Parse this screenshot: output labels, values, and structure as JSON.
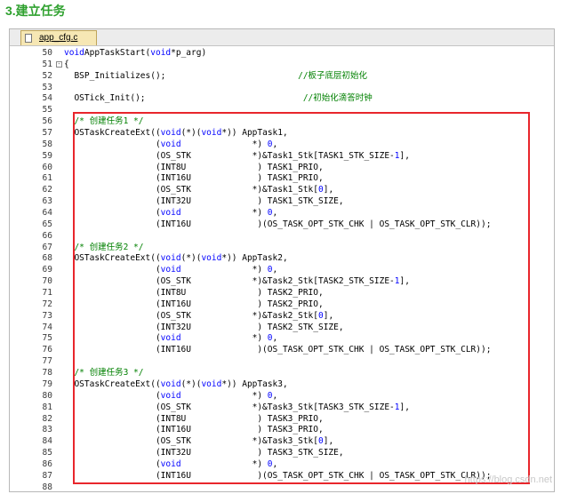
{
  "heading": "3.建立任务",
  "tab_label": "app_cfg.c",
  "watermark": "https://blog.csdn.net",
  "lines": [
    {
      "n": "50",
      "t": [
        [
          "kw",
          "void"
        ],
        [
          "",
          "AppTaskStart("
        ],
        [
          "kw",
          "void"
        ],
        [
          "",
          "*p_arg)"
        ]
      ]
    },
    {
      "n": "51",
      "fold": "-",
      "t": [
        [
          "",
          "{"
        ]
      ]
    },
    {
      "n": "52",
      "t": [
        [
          "",
          "  BSP_Initializes();                          "
        ],
        [
          "cm",
          "//板子底层初始化"
        ]
      ]
    },
    {
      "n": "53",
      "t": []
    },
    {
      "n": "54",
      "t": [
        [
          "",
          "  OSTick_Init();                               "
        ],
        [
          "cm",
          "//初始化滴答时钟"
        ]
      ]
    },
    {
      "n": "55",
      "t": []
    },
    {
      "n": "56",
      "t": [
        [
          "cm",
          "  /* 创建任务1 */"
        ]
      ]
    },
    {
      "n": "57",
      "t": [
        [
          "",
          "  OSTaskCreateExt(("
        ],
        [
          "kw",
          "void"
        ],
        [
          "",
          "(*)("
        ],
        [
          "kw",
          "void"
        ],
        [
          "",
          "*)) AppTask1,"
        ]
      ]
    },
    {
      "n": "58",
      "t": [
        [
          "",
          "                  ("
        ],
        [
          "kw",
          "void"
        ],
        [
          "",
          "              *) "
        ],
        [
          "kw",
          "0"
        ],
        [
          "",
          ","
        ]
      ]
    },
    {
      "n": "59",
      "t": [
        [
          "",
          "                  (OS_STK            *)&Task1_Stk[TASK1_STK_SIZE-"
        ],
        [
          "kw",
          "1"
        ],
        [
          "",
          "],"
        ]
      ]
    },
    {
      "n": "60",
      "t": [
        [
          "",
          "                  (INT8U              ) TASK1_PRIO,"
        ]
      ]
    },
    {
      "n": "61",
      "t": [
        [
          "",
          "                  (INT16U             ) TASK1_PRIO,"
        ]
      ]
    },
    {
      "n": "62",
      "t": [
        [
          "",
          "                  (OS_STK            *)&Task1_Stk["
        ],
        [
          "kw",
          "0"
        ],
        [
          "",
          "],"
        ]
      ]
    },
    {
      "n": "63",
      "t": [
        [
          "",
          "                  (INT32U             ) TASK1_STK_SIZE,"
        ]
      ]
    },
    {
      "n": "64",
      "t": [
        [
          "",
          "                  ("
        ],
        [
          "kw",
          "void"
        ],
        [
          "",
          "              *) "
        ],
        [
          "kw",
          "0"
        ],
        [
          "",
          ","
        ]
      ]
    },
    {
      "n": "65",
      "t": [
        [
          "",
          "                  (INT16U             )(OS_TASK_OPT_STK_CHK | OS_TASK_OPT_STK_CLR));"
        ]
      ]
    },
    {
      "n": "66",
      "t": []
    },
    {
      "n": "67",
      "t": [
        [
          "cm",
          "  /* 创建任务2 */"
        ]
      ]
    },
    {
      "n": "68",
      "t": [
        [
          "",
          "  OSTaskCreateExt(("
        ],
        [
          "kw",
          "void"
        ],
        [
          "",
          "(*)("
        ],
        [
          "kw",
          "void"
        ],
        [
          "",
          "*)) AppTask2,"
        ]
      ]
    },
    {
      "n": "69",
      "t": [
        [
          "",
          "                  ("
        ],
        [
          "kw",
          "void"
        ],
        [
          "",
          "              *) "
        ],
        [
          "kw",
          "0"
        ],
        [
          "",
          ","
        ]
      ]
    },
    {
      "n": "70",
      "t": [
        [
          "",
          "                  (OS_STK            *)&Task2_Stk[TASK2_STK_SIZE-"
        ],
        [
          "kw",
          "1"
        ],
        [
          "",
          "],"
        ]
      ]
    },
    {
      "n": "71",
      "t": [
        [
          "",
          "                  (INT8U              ) TASK2_PRIO,"
        ]
      ]
    },
    {
      "n": "72",
      "t": [
        [
          "",
          "                  (INT16U             ) TASK2_PRIO,"
        ]
      ]
    },
    {
      "n": "73",
      "t": [
        [
          "",
          "                  (OS_STK            *)&Task2_Stk["
        ],
        [
          "kw",
          "0"
        ],
        [
          "",
          "],"
        ]
      ]
    },
    {
      "n": "74",
      "t": [
        [
          "",
          "                  (INT32U             ) TASK2_STK_SIZE,"
        ]
      ]
    },
    {
      "n": "75",
      "t": [
        [
          "",
          "                  ("
        ],
        [
          "kw",
          "void"
        ],
        [
          "",
          "              *) "
        ],
        [
          "kw",
          "0"
        ],
        [
          "",
          ","
        ]
      ]
    },
    {
      "n": "76",
      "t": [
        [
          "",
          "                  (INT16U             )(OS_TASK_OPT_STK_CHK | OS_TASK_OPT_STK_CLR));"
        ]
      ]
    },
    {
      "n": "77",
      "t": []
    },
    {
      "n": "78",
      "t": [
        [
          "cm",
          "  /* 创建任务3 */"
        ]
      ]
    },
    {
      "n": "79",
      "t": [
        [
          "",
          "  OSTaskCreateExt(("
        ],
        [
          "kw",
          "void"
        ],
        [
          "",
          "(*)("
        ],
        [
          "kw",
          "void"
        ],
        [
          "",
          "*)) AppTask3,"
        ]
      ]
    },
    {
      "n": "80",
      "t": [
        [
          "",
          "                  ("
        ],
        [
          "kw",
          "void"
        ],
        [
          "",
          "              *) "
        ],
        [
          "kw",
          "0"
        ],
        [
          "",
          ","
        ]
      ]
    },
    {
      "n": "81",
      "t": [
        [
          "",
          "                  (OS_STK            *)&Task3_Stk[TASK3_STK_SIZE-"
        ],
        [
          "kw",
          "1"
        ],
        [
          "",
          "],"
        ]
      ]
    },
    {
      "n": "82",
      "t": [
        [
          "",
          "                  (INT8U              ) TASK3_PRIO,"
        ]
      ]
    },
    {
      "n": "83",
      "t": [
        [
          "",
          "                  (INT16U             ) TASK3_PRIO,"
        ]
      ]
    },
    {
      "n": "84",
      "t": [
        [
          "",
          "                  (OS_STK            *)&Task3_Stk["
        ],
        [
          "kw",
          "0"
        ],
        [
          "",
          "],"
        ]
      ]
    },
    {
      "n": "85",
      "t": [
        [
          "",
          "                  (INT32U             ) TASK3_STK_SIZE,"
        ]
      ]
    },
    {
      "n": "86",
      "t": [
        [
          "",
          "                  ("
        ],
        [
          "kw",
          "void"
        ],
        [
          "",
          "              *) "
        ],
        [
          "kw",
          "0"
        ],
        [
          "",
          ","
        ]
      ]
    },
    {
      "n": "87",
      "t": [
        [
          "",
          "                  (INT16U             )(OS_TASK_OPT_STK_CHK | OS_TASK_OPT_STK_CLR));"
        ]
      ]
    },
    {
      "n": "88",
      "t": []
    }
  ]
}
